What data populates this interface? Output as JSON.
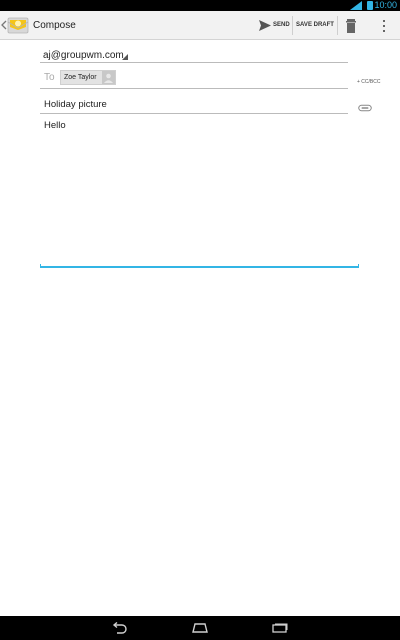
{
  "status_bar": {
    "time": "10:00"
  },
  "action_bar": {
    "title": "Compose",
    "send_label": "SEND",
    "save_draft_label": "SAVE DRAFT"
  },
  "compose": {
    "from_account": "aj@groupwm.com",
    "to_label": "To",
    "recipient_chip": "Zoe Taylor",
    "cc_bcc_label": "+ CC/BCC",
    "subject": "Holiday picture",
    "body": "Hello"
  },
  "colors": {
    "accent": "#33b5e5",
    "action_bar_bg": "#f2f2f2",
    "system_bar_bg": "#000000"
  },
  "icons": {
    "up": "caret-left-icon",
    "app": "email-app-icon",
    "send": "send-icon",
    "discard": "trash-icon",
    "overflow": "overflow-menu-icon",
    "attach": "attachment-icon",
    "wifi": "wifi-signal-icon",
    "battery": "battery-icon",
    "back": "back-icon",
    "home": "home-icon",
    "recents": "recent-apps-icon"
  }
}
